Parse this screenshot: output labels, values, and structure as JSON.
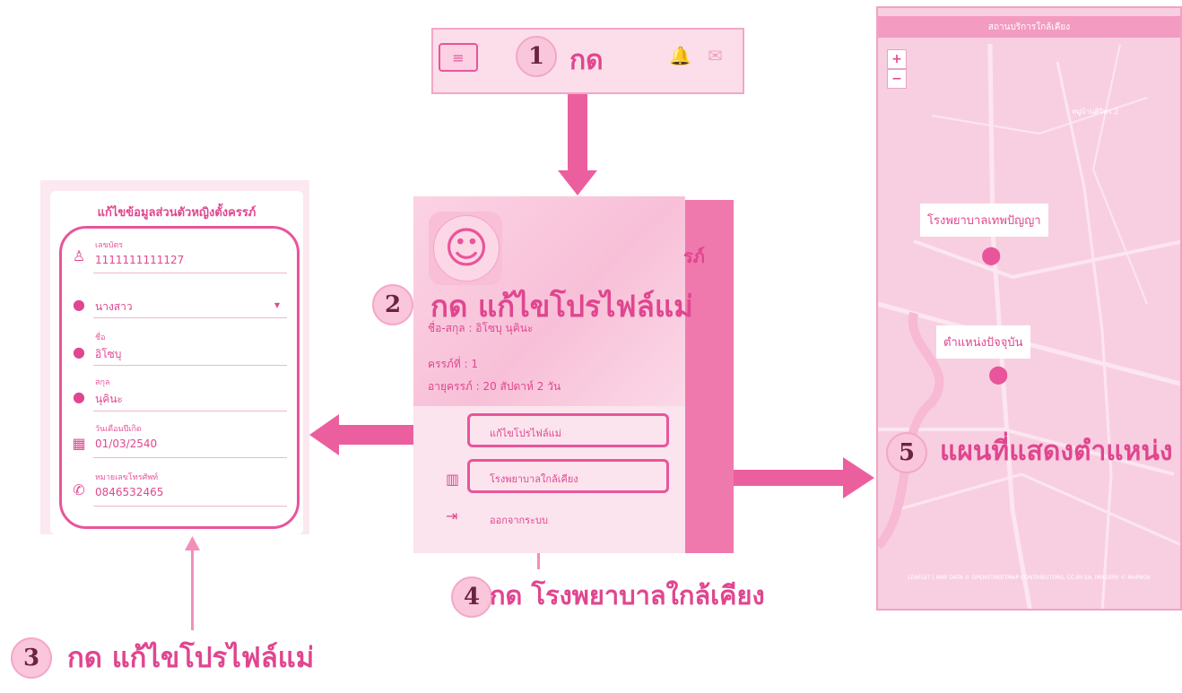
{
  "top_bar": {
    "menu_icon": "hamburger-menu-icon",
    "menu_glyph": "≡",
    "bell_icon": "bell-icon",
    "bell_glyph": "🔔",
    "mail_icon": "mail-icon",
    "mail_glyph": "✉"
  },
  "steps": [
    {
      "number": "1",
      "caption": "กด"
    },
    {
      "number": "2",
      "caption": "กด แก้ไขโปรไฟล์แม่"
    },
    {
      "number": "3",
      "caption": "กด แก้ไขโปรไฟล์แม่"
    },
    {
      "number": "4",
      "caption": "กด โรงพยาบาลใกล้เคียง"
    },
    {
      "number": "5",
      "caption": "แผนที่แสดงตำแหน่ง"
    }
  ],
  "drawer": {
    "name_line": "ชื่อ-สกุล : อิโซบุ นุคินะ",
    "pregnancy_line": "ครรภ์ที่ : 1",
    "age_line": "อายุครรภ์ : 20 สัปดาห์ 2 วัน",
    "partial_header": "รภ์",
    "items": [
      {
        "icon": "person-icon",
        "label": "แก้ไขโปรไฟล์แม่"
      },
      {
        "icon": "map-icon",
        "label": "โรงพยาบาลใกล้เคียง"
      },
      {
        "icon": "logout-icon",
        "label": "ออกจากระบบ"
      }
    ],
    "avatar_glyph": "☺"
  },
  "form": {
    "title": "แก้ไขข้อมูลส่วนตัวหญิงตั้งครรภ์",
    "fields": [
      {
        "label": "เลขบัตร",
        "value": "1111111111127",
        "icon": "person-outline-icon",
        "glyph": "♙"
      },
      {
        "label": "",
        "value": "นางสาว",
        "icon": "account-circle-icon",
        "glyph": "●",
        "dropdown": "▾"
      },
      {
        "label": "ชื่อ",
        "value": "อิโซบุ",
        "icon": "account-circle-icon",
        "glyph": "●"
      },
      {
        "label": "สกุล",
        "value": "นุคินะ",
        "icon": "account-circle-icon",
        "glyph": "●"
      },
      {
        "label": "วันเดือนปีเกิด",
        "value": "01/03/2540",
        "icon": "calendar-icon",
        "glyph": "▦"
      },
      {
        "label": "หมายเลขโทรศัพท์",
        "value": "0846532465",
        "icon": "phone-icon",
        "glyph": "✆"
      }
    ]
  },
  "map": {
    "header": "สถานบริการใกล้เคียง",
    "zoom_in": "+",
    "zoom_out": "−",
    "corner_label": "หมู่บ้านศิริพร 2",
    "hospital_label": "โรงพยาบาลเทพปัญญา",
    "current_label": "ตำแหน่งปัจจุบัน",
    "pin_glyph": "⬤",
    "attribution": "LEAFLET | MAP DATA © OPENSTREETMAP CONTRIBUTORS, CC-BY-SA, IMAGERY © MAPBOX"
  },
  "colors": {
    "accent": "#e8559a",
    "accent_dark": "#e0468f",
    "light_pink": "#fbdeea",
    "step_circle": "#f9c6dc"
  }
}
